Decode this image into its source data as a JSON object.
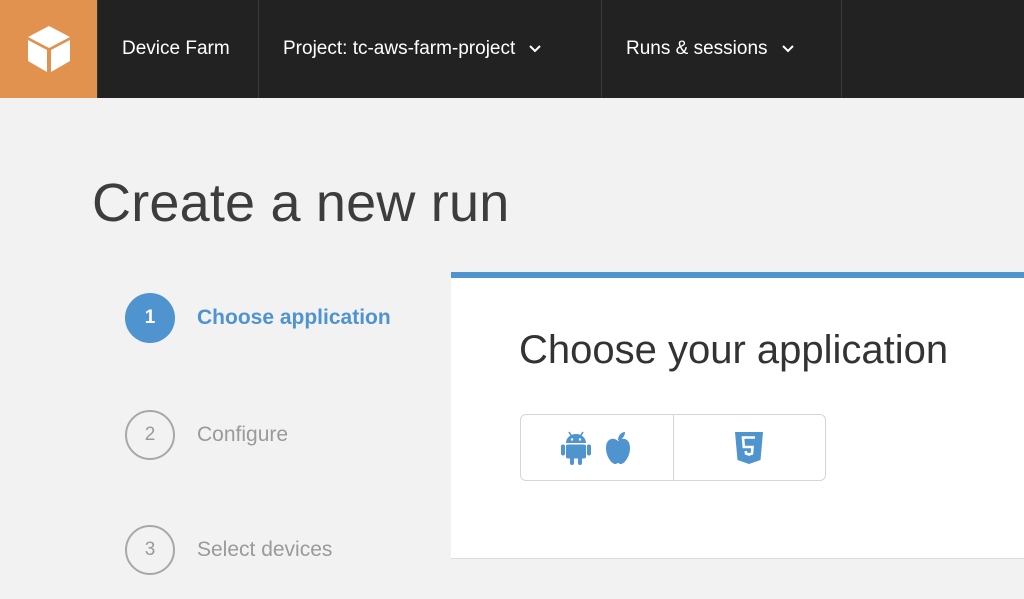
{
  "header": {
    "logo_icon": "cube-icon",
    "brand": "Device Farm",
    "project_label": "Project: tc-aws-farm-project",
    "runs_label": "Runs & sessions",
    "logo_color": "#e0924e",
    "bar_color": "#222222"
  },
  "page": {
    "title": "Create a new run"
  },
  "steps": [
    {
      "number": "1",
      "label": "Choose application",
      "state": "active"
    },
    {
      "number": "2",
      "label": "Configure",
      "state": "inactive"
    },
    {
      "number": "3",
      "label": "Select devices",
      "state": "inactive"
    }
  ],
  "panel": {
    "title": "Choose your application",
    "accent_color": "#4f93cf",
    "platforms": [
      {
        "name": "native",
        "icons": [
          "android-icon",
          "apple-icon"
        ]
      },
      {
        "name": "web",
        "icons": [
          "html5-icon"
        ]
      }
    ]
  }
}
